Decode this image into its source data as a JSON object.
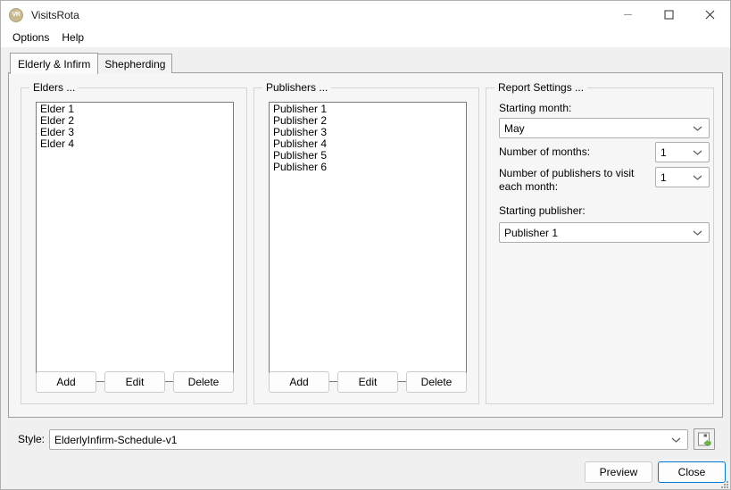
{
  "window": {
    "title": "VisitsRota",
    "app_icon": "vr-badge-icon",
    "controls": {
      "minimize": "minimize-icon",
      "maximize": "maximize-icon",
      "close": "close-icon"
    }
  },
  "menubar": {
    "items": [
      {
        "label": "Options"
      },
      {
        "label": "Help"
      }
    ]
  },
  "tabs": [
    {
      "label": "Elderly & Infirm",
      "selected": true
    },
    {
      "label": "Shepherding",
      "selected": false
    }
  ],
  "elders": {
    "group_title": "Elders ...",
    "items": [
      "Elder 1",
      "Elder 2",
      "Elder 3",
      "Elder 4"
    ],
    "buttons": [
      {
        "label": "Add"
      },
      {
        "label": "Edit"
      },
      {
        "label": "Delete"
      }
    ]
  },
  "publishers": {
    "group_title": "Publishers ...",
    "items": [
      "Publisher 1",
      "Publisher 2",
      "Publisher 3",
      "Publisher 4",
      "Publisher 5",
      "Publisher 6"
    ],
    "buttons": [
      {
        "label": "Add"
      },
      {
        "label": "Edit"
      },
      {
        "label": "Delete"
      }
    ]
  },
  "report_settings": {
    "group_title": "Report Settings ...",
    "starting_month": {
      "label": "Starting month:",
      "value": "May"
    },
    "number_of_months": {
      "label": "Number of months:",
      "value": "1"
    },
    "number_of_publishers": {
      "label": "Number of publishers to visit each month:",
      "value": "1"
    },
    "starting_publisher": {
      "label": "Starting publisher:",
      "value": "Publisher 1"
    }
  },
  "style_bar": {
    "label": "Style:",
    "value": "ElderlyInfirm-Schedule-v1",
    "save_icon": "save-document-icon"
  },
  "footer": {
    "preview_label": "Preview",
    "close_label": "Close"
  },
  "colors": {
    "window_background": "#f0f0f0",
    "panel_background": "#f6f6f6",
    "accent": "#0078d7",
    "icon_gold": "#c8b98e",
    "icon_green": "#6cc04a"
  }
}
